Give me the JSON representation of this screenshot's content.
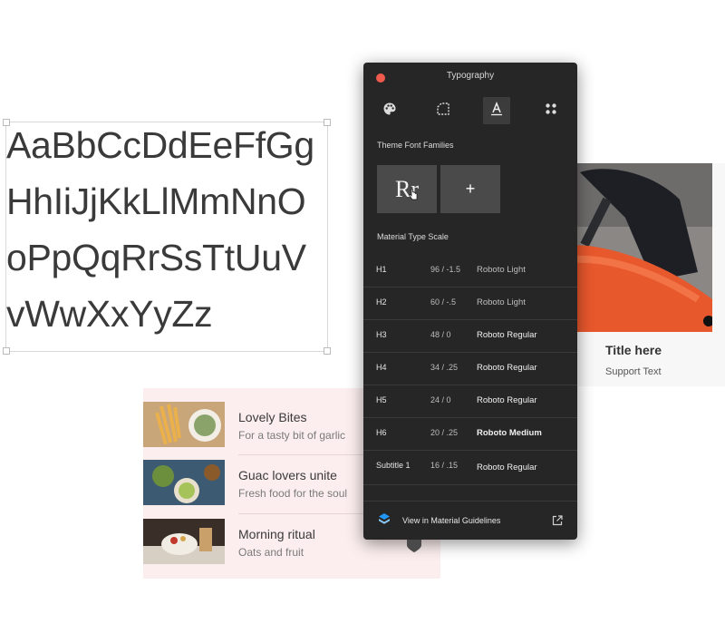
{
  "specimen": {
    "lines": [
      "AaBbCcDdEeFfGg",
      "HhIiJjKkLlMmNnO",
      "oPpQqRrSsTtUuV",
      "vWwXxYyZz"
    ]
  },
  "card": {
    "title": "Title here",
    "subtitle": "Support Text"
  },
  "list": {
    "items": [
      {
        "title": "Lovely Bites",
        "subtitle": "For a tasty bit of garlic"
      },
      {
        "title": "Guac lovers unite",
        "subtitle": "Fresh food for the soul"
      },
      {
        "title": "Morning ritual",
        "subtitle": "Oats and fruit"
      }
    ]
  },
  "panel": {
    "title": "Typography",
    "tabs": [
      "palette-icon",
      "shape-icon",
      "typography-icon",
      "components-icon"
    ],
    "active_tab": "typography-icon",
    "theme_label": "Theme Font Families",
    "font_sample": "Rr",
    "add_label": "+",
    "scale_label": "Material Type Scale",
    "scale": [
      {
        "name": "H1",
        "size": "96 / -1.5",
        "font": "Roboto Light"
      },
      {
        "name": "H2",
        "size": "60 / -.5",
        "font": "Roboto Light"
      },
      {
        "name": "H3",
        "size": "48 / 0",
        "font": "Roboto Regular"
      },
      {
        "name": "H4",
        "size": "34 / .25",
        "font": "Roboto Regular"
      },
      {
        "name": "H5",
        "size": "24 / 0",
        "font": "Roboto Regular"
      },
      {
        "name": "H6",
        "size": "20 / .25",
        "font": "Roboto Medium"
      },
      {
        "name": "Subtitle 1",
        "size": "16 / .15",
        "font": "Roboto Regular"
      }
    ],
    "footer_link": "View in Material Guidelines"
  },
  "colors": {
    "panel_bg": "#262626",
    "close": "#ee5b4c",
    "list_bg": "#fceeee",
    "accent_blue": "#2196f3"
  }
}
